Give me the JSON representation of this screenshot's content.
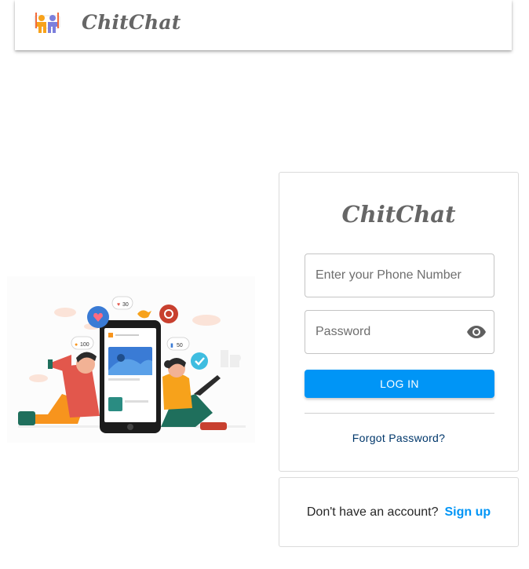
{
  "header": {
    "brand": "ChitChat",
    "logo_icon": "friends-logo-icon"
  },
  "illustration": {
    "icon": "social-media-illustration",
    "badges": {
      "likes": "30",
      "followers": "100",
      "shares": "50"
    }
  },
  "login": {
    "title": "ChitChat",
    "phone_placeholder": "Enter your Phone Number",
    "password_placeholder": "Password",
    "toggle_icon": "eye-icon",
    "login_label": "LOG IN",
    "forgot_label": "Forgot Password?"
  },
  "signup": {
    "prompt": "Don't have an account?",
    "link": "Sign up"
  },
  "colors": {
    "accent": "#0095f6",
    "link_dark": "#00376b",
    "brand_text": "#666666"
  }
}
